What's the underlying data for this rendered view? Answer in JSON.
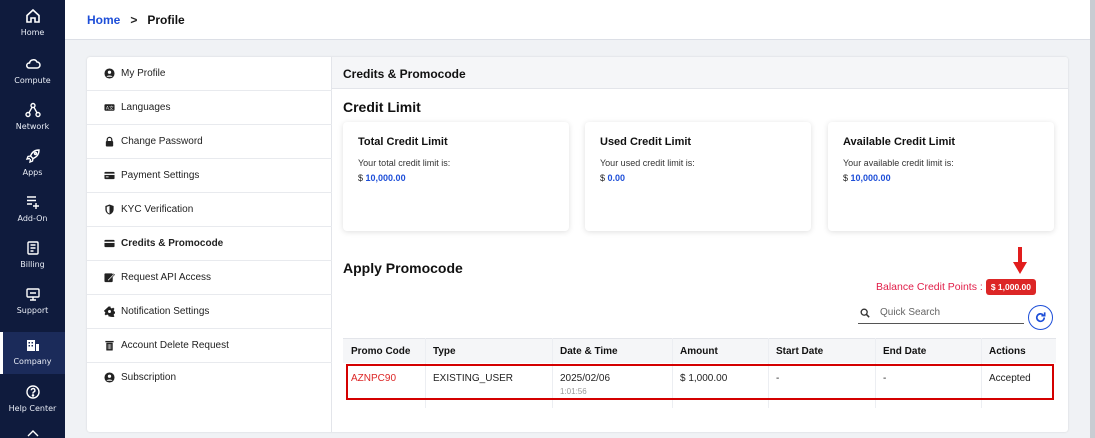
{
  "nav": {
    "items": [
      {
        "label": "Home",
        "icon": "home-icon"
      },
      {
        "label": "Compute",
        "icon": "cloud-icon"
      },
      {
        "label": "Network",
        "icon": "network-icon"
      },
      {
        "label": "Apps",
        "icon": "rocket-icon"
      },
      {
        "label": "Add-On",
        "icon": "add-list-icon"
      },
      {
        "label": "Billing",
        "icon": "receipt-icon"
      },
      {
        "label": "Support",
        "icon": "support-icon"
      },
      {
        "label": "Company",
        "icon": "building-icon"
      },
      {
        "label": "Help Center",
        "icon": "help-icon"
      }
    ]
  },
  "breadcrumb": {
    "home": "Home",
    "separator": ">",
    "current": "Profile"
  },
  "menu": {
    "items": [
      {
        "label": "My Profile",
        "icon": "user-circle-icon"
      },
      {
        "label": "Languages",
        "icon": "language-icon"
      },
      {
        "label": "Change Password",
        "icon": "lock-icon"
      },
      {
        "label": "Payment Settings",
        "icon": "credit-card-icon"
      },
      {
        "label": "KYC Verification",
        "icon": "shield-icon"
      },
      {
        "label": "Credits & Promocode",
        "icon": "card-icon"
      },
      {
        "label": "Request API Access",
        "icon": "edit-icon"
      },
      {
        "label": "Notification Settings",
        "icon": "gear-icon"
      },
      {
        "label": "Account Delete Request",
        "icon": "trash-icon"
      },
      {
        "label": "Subscription",
        "icon": "user-circle-icon"
      }
    ]
  },
  "content": {
    "header": "Credits & Promocode",
    "credit_limit_title": "Credit Limit",
    "cards": [
      {
        "title": "Total Credit Limit",
        "desc": "Your total credit limit is:",
        "currency": "$",
        "value": "10,000.00"
      },
      {
        "title": "Used Credit Limit",
        "desc": "Your used credit limit is:",
        "currency": "$",
        "value": "0.00"
      },
      {
        "title": "Available Credit Limit",
        "desc": "Your available credit limit is:",
        "currency": "$",
        "value": "10,000.00"
      }
    ],
    "promo_title": "Apply Promocode",
    "balance_label": "Balance Credit Points :",
    "balance_value": "$ 1,000.00",
    "search_placeholder": "Quick Search",
    "table": {
      "headers": [
        "Promo Code",
        "Type",
        "Date & Time",
        "Amount",
        "Start Date",
        "End Date",
        "Actions"
      ],
      "rows": [
        {
          "code": "AZNPC90",
          "type": "EXISTING_USER",
          "date": "2025/02/06",
          "time": "1:01:56",
          "amount": "$ 1,000.00",
          "start": "-",
          "end": "-",
          "action": "Accepted"
        }
      ]
    }
  },
  "colors": {
    "nav_bg": "#0f1b3d",
    "accent": "#1d4ed8",
    "danger": "#dc2626"
  }
}
